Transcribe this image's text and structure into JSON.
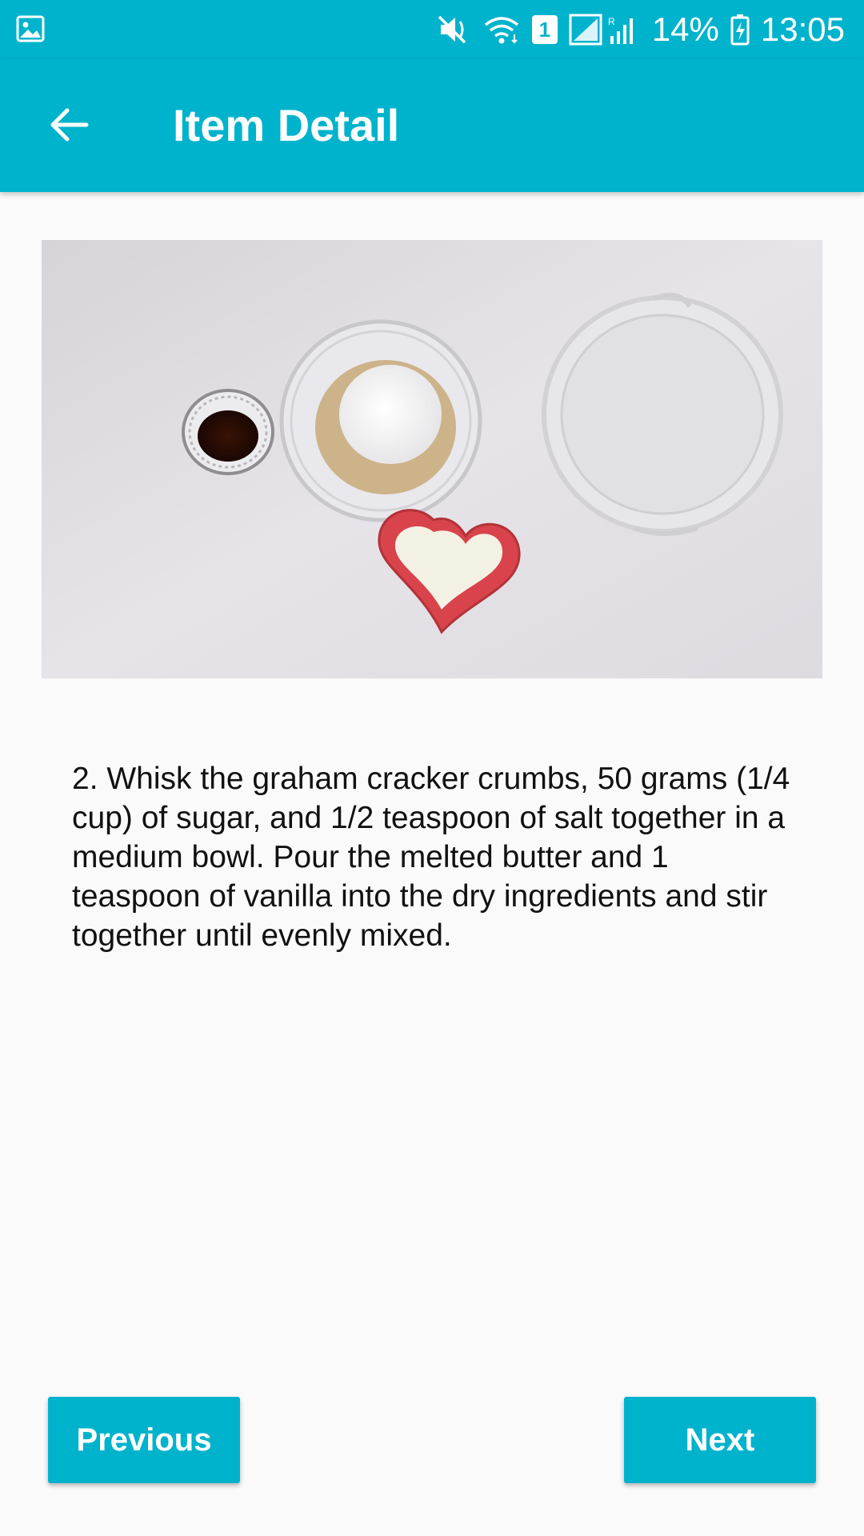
{
  "theme": {
    "primary": "#00b3cc",
    "background": "#fafafa"
  },
  "status_bar": {
    "left_icons": [
      "gallery-icon"
    ],
    "right_icons": [
      "mute-icon",
      "wifi-icon",
      "sim-1-icon",
      "signal-icon",
      "battery-charging-icon"
    ],
    "sim_badge": "1",
    "battery_percent": "14%",
    "time": "13:05"
  },
  "app_bar": {
    "title": "Item Detail",
    "back_icon": "arrow-left-icon"
  },
  "step": {
    "text": "2. Whisk the graham cracker crumbs, 50 grams (1/4 cup) of sugar, and 1/2 teaspoon of salt together in a medium bowl. Pour the melted butter and 1 teaspoon of vanilla into the dry ingredients and stir together until evenly mixed."
  },
  "buttons": {
    "previous": "Previous",
    "next": "Next"
  }
}
